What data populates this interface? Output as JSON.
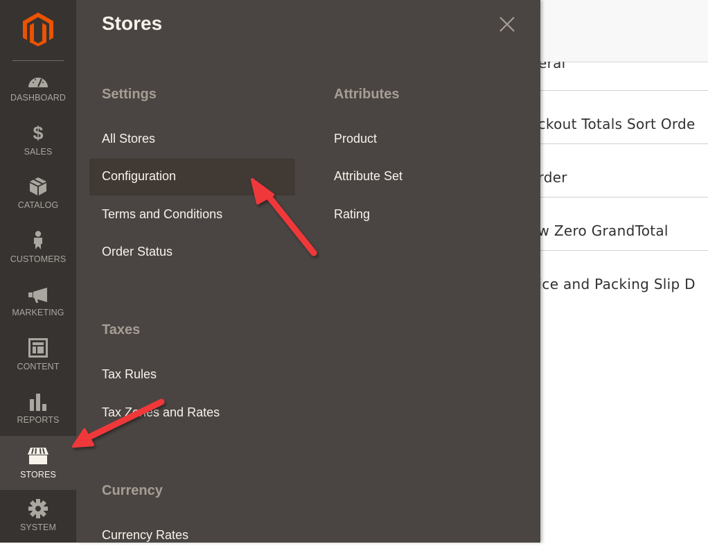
{
  "nav": {
    "logo": "magento-logo",
    "items": [
      {
        "label": "DASHBOARD",
        "icon": "dashboard-gauge-icon"
      },
      {
        "label": "SALES",
        "icon": "dollar-icon"
      },
      {
        "label": "CATALOG",
        "icon": "box-icon"
      },
      {
        "label": "CUSTOMERS",
        "icon": "person-icon"
      },
      {
        "label": "MARKETING",
        "icon": "megaphone-icon"
      },
      {
        "label": "CONTENT",
        "icon": "layout-icon"
      },
      {
        "label": "REPORTS",
        "icon": "bar-chart-icon"
      },
      {
        "label": "STORES",
        "icon": "storefront-icon",
        "active": true
      },
      {
        "label": "SYSTEM",
        "icon": "gear-icon"
      }
    ]
  },
  "panel": {
    "title": "Stores",
    "close_icon": "close-icon",
    "groups": [
      {
        "title": "Settings",
        "links": [
          "All Stores",
          "Configuration",
          "Terms and Conditions",
          "Order Status"
        ]
      },
      {
        "title": "Taxes",
        "links": [
          "Tax Rules",
          "Tax Zones and Rates"
        ]
      },
      {
        "title": "Currency",
        "links": [
          "Currency Rates"
        ]
      },
      {
        "title": "Attributes",
        "links": [
          "Product",
          "Attribute Set",
          "Rating"
        ]
      }
    ],
    "highlighted_link": "Configuration"
  },
  "background": {
    "rows": [
      "General",
      "Checkout Totals Sort Order",
      "Reorder",
      "Allow Zero GrandTotal",
      "Invoice and Packing Slip Design"
    ],
    "visible_fragments": [
      "neral",
      "eckout Totals Sort Orde",
      "order",
      "ow Zero GrandTotal",
      "oice and Packing Slip D"
    ]
  },
  "colors": {
    "nav_bg": "#373330",
    "panel_bg": "#4a4542",
    "accent_orange": "#eb5202",
    "arrow_red": "#f0373a",
    "group_title": "#a79d95",
    "link_text": "#f7f3eb"
  }
}
